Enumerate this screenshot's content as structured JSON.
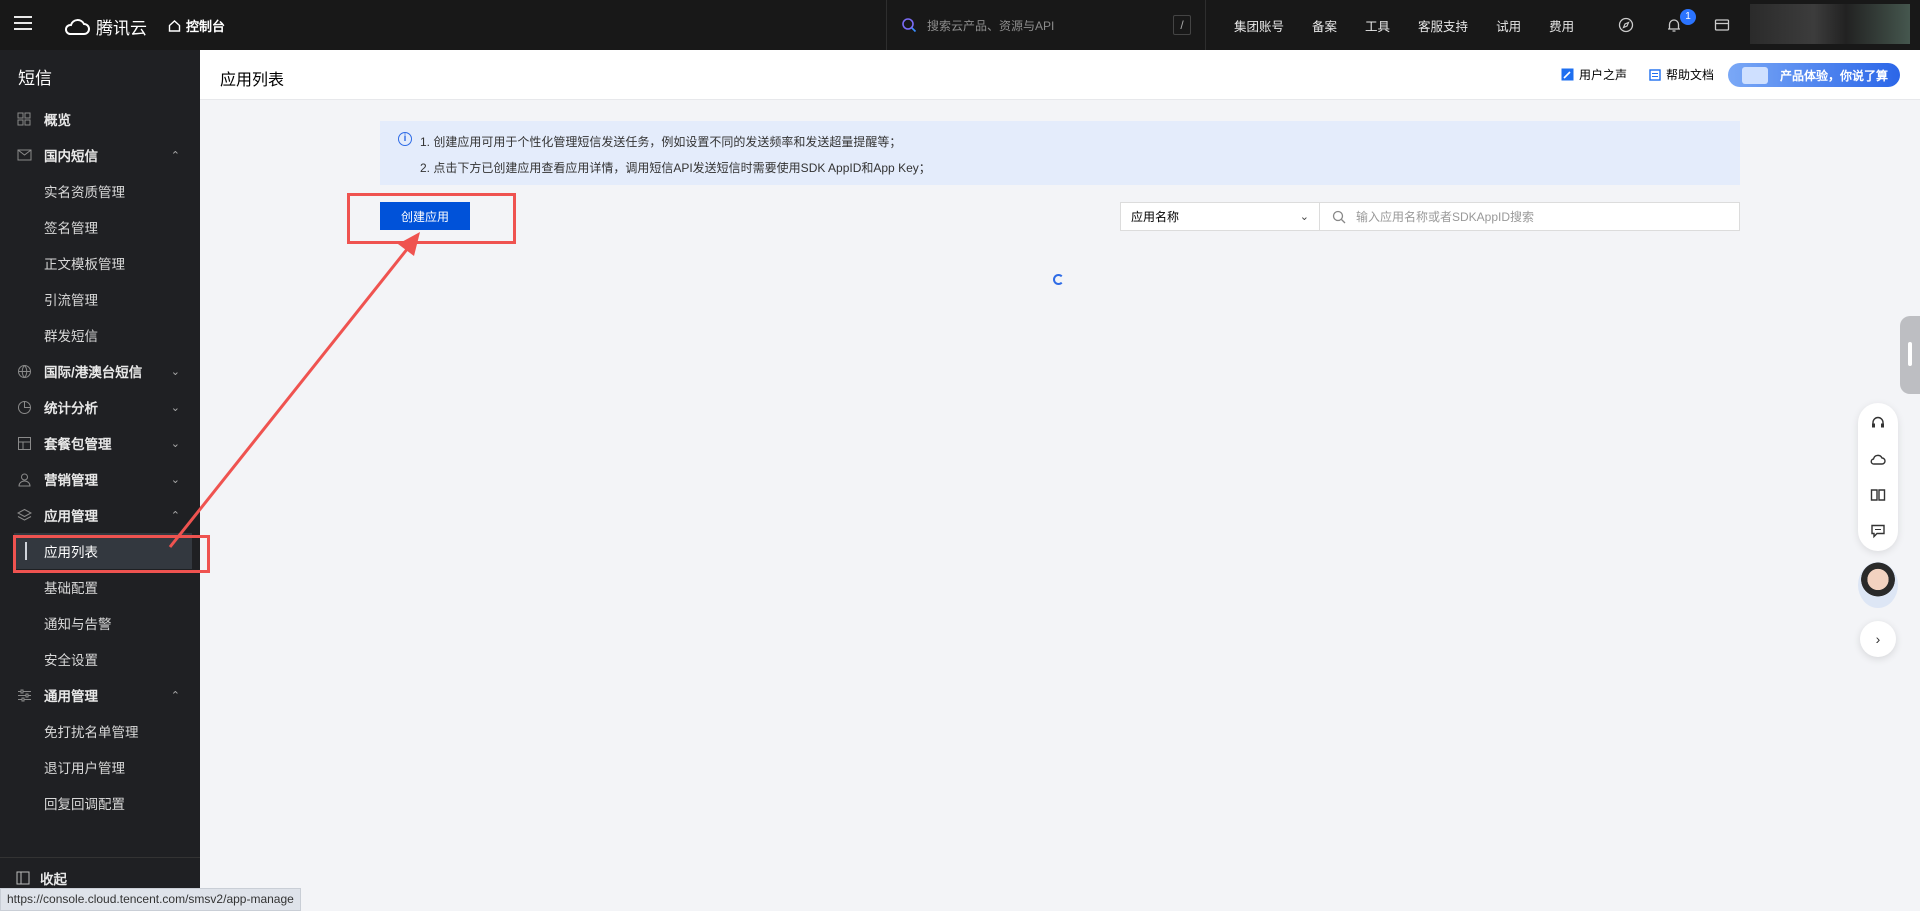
{
  "topbar": {
    "logo_text": "腾讯云",
    "console_label": "控制台",
    "search_placeholder": "搜索云产品、资源与API",
    "search_shortcut": "/",
    "nav": [
      "集团账号",
      "备案",
      "工具",
      "客服支持",
      "试用",
      "费用"
    ],
    "notification_count": "1"
  },
  "sidebar": {
    "title": "短信",
    "items": [
      {
        "label": "概览",
        "icon": "grid-icon"
      },
      {
        "label": "国内短信",
        "icon": "mail-icon",
        "expanded": true,
        "children": [
          "实名资质管理",
          "签名管理",
          "正文模板管理",
          "引流管理",
          "群发短信"
        ]
      },
      {
        "label": "国际/港澳台短信",
        "icon": "globe-icon",
        "expanded": false
      },
      {
        "label": "统计分析",
        "icon": "pie-chart-icon",
        "expanded": false
      },
      {
        "label": "套餐包管理",
        "icon": "package-icon",
        "expanded": false
      },
      {
        "label": "营销管理",
        "icon": "user-group-icon",
        "expanded": false
      },
      {
        "label": "应用管理",
        "icon": "layers-icon",
        "expanded": true,
        "children": [
          "应用列表",
          "基础配置",
          "通知与告警",
          "安全设置"
        ],
        "active_child": "应用列表"
      },
      {
        "label": "通用管理",
        "icon": "sliders-icon",
        "expanded": true,
        "children": [
          "免打扰名单管理",
          "退订用户管理",
          "回复回调配置"
        ]
      }
    ],
    "collapse_label": "收起"
  },
  "header": {
    "page_title": "应用列表",
    "user_voice": "用户之声",
    "help_docs": "帮助文档",
    "feedback": "产品体验，你说了算"
  },
  "notice": {
    "line1": "1. 创建应用可用于个性化管理短信发送任务，例如设置不同的发送频率和发送超量提醒等；",
    "line2": "2. 点击下方已创建应用查看应用详情，调用短信API发送短信时需要使用SDK AppID和App Key；"
  },
  "toolbar": {
    "create_label": "创建应用",
    "filter_selected": "应用名称",
    "search_placeholder": "输入应用名称或者SDKAppID搜索"
  },
  "status_url": "https://console.cloud.tencent.com/smsv2/app-manage",
  "colors": {
    "primary": "#0052d9",
    "annotation": "#ef5350",
    "sidebar_bg": "#1f2023",
    "topbar_bg": "#181818"
  }
}
